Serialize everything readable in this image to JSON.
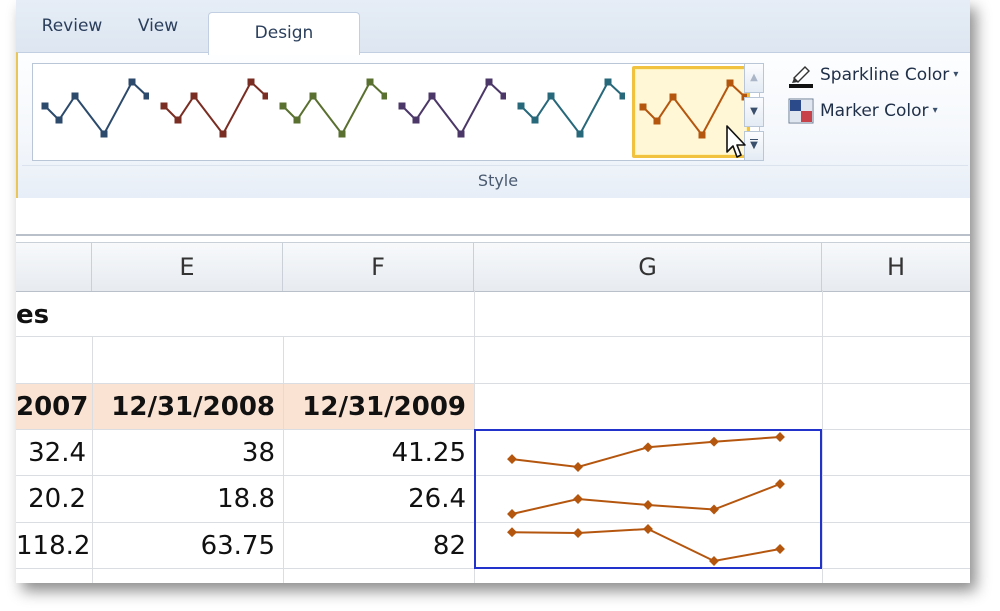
{
  "tabs": [
    {
      "label": "Review"
    },
    {
      "label": "View"
    },
    {
      "label": "Design"
    }
  ],
  "ribbon": {
    "group_label": "Style",
    "sparkline_color_label": "Sparkline Color",
    "marker_color_label": "Marker Color",
    "style_colors": [
      "#2c4a6b",
      "#7a2d22",
      "#5a7030",
      "#4b3868",
      "#27687a",
      "#b5560f"
    ],
    "selected_style_index": 5,
    "icons": {
      "gallery_up": "▲",
      "gallery_down": "▼",
      "gallery_more": "▼",
      "caret": "▾"
    }
  },
  "columns": [
    "E",
    "F",
    "G",
    "H"
  ],
  "sheet": {
    "title_fragment": "es",
    "dates": [
      "2007",
      "12/31/2008",
      "12/31/2009"
    ],
    "rows": [
      [
        "32.4",
        "38",
        "41.25"
      ],
      [
        "20.2",
        "18.8",
        "26.4"
      ],
      [
        "118.2",
        "63.75",
        "82"
      ]
    ]
  },
  "sparkline_color": "#b5560f",
  "sparklines": [
    [
      1,
      0,
      2.5,
      3.2,
      3.8
    ],
    [
      1,
      3,
      2.2,
      1.6,
      5
    ],
    [
      3.6,
      3.5,
      4,
      0,
      1.5
    ]
  ]
}
